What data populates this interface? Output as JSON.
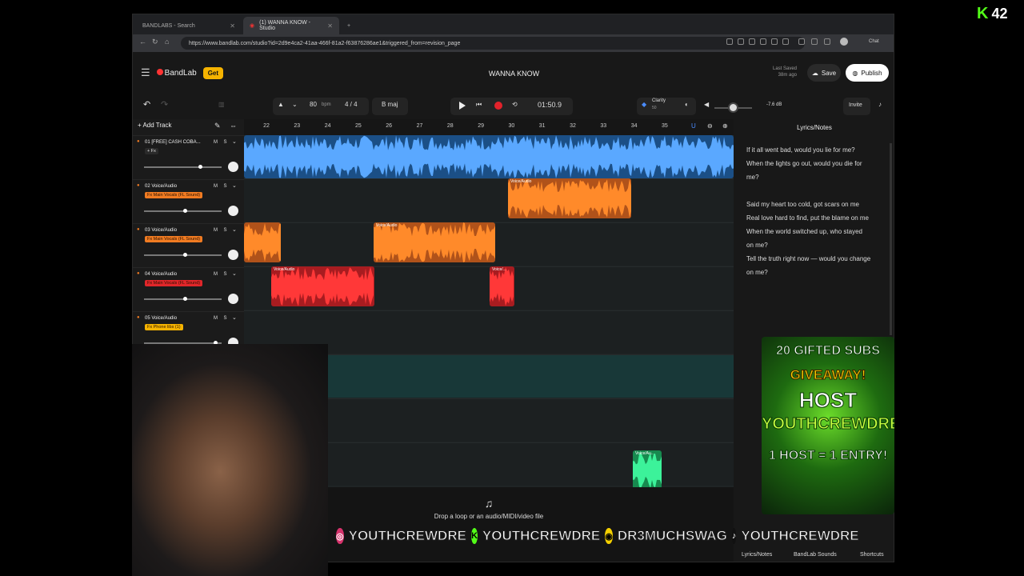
{
  "browser": {
    "tabs": [
      {
        "label": "BANDLABS - Search"
      },
      {
        "label": "(1) WANNA KNOW - Studio"
      }
    ],
    "url": "https://www.bandlab.com/studio?id=2d9e4ca2-41aa-466f-81a2-f63876286ae1&triggered_from=revision_page",
    "chat_label": "Chat"
  },
  "header": {
    "brand": "BandLab",
    "get_label": "Get",
    "title": "WANNA KNOW",
    "last_saved_1": "Last Saved",
    "last_saved_2": "38m ago",
    "save_label": "Save",
    "publish_label": "Publish"
  },
  "toolbar": {
    "bpm": "80",
    "bpm_unit": "bpm",
    "time_sig": "4 / 4",
    "key": "B maj",
    "time": "01:50.9",
    "clarity": "Clarity",
    "clarity_val": "50",
    "db": "-7.6 dB",
    "invite": "Invite"
  },
  "tracks": {
    "add_track": "Add Track",
    "items": [
      {
        "name": "01  [FREE] CASH COBA...",
        "fx": "+ Fx",
        "fx_color": "#2a2a2a",
        "vol": 0.72
      },
      {
        "name": "02  Voice/Audio",
        "fx": "Fx  Main Vocals (FL Sound)",
        "fx_color": "#f07b22",
        "vol": 0.53
      },
      {
        "name": "03  Voice/Audio",
        "fx": "Fx  Main Vocals (FL Sound)",
        "fx_color": "#f07b22",
        "vol": 0.53
      },
      {
        "name": "04  Voice/Audio",
        "fx": "Fx  Main Vocals (FL Sound)",
        "fx_color": "#e0262a",
        "vol": 0.53
      },
      {
        "name": "05  Voice/Audio",
        "fx": "Fx  Phone libs (1)",
        "fx_color": "#f5b300",
        "vol": 0.92
      }
    ]
  },
  "ruler": [
    "22",
    "23",
    "24",
    "25",
    "26",
    "27",
    "28",
    "29",
    "30",
    "31",
    "32",
    "33",
    "34",
    "35"
  ],
  "clips": {
    "label": "Voice/Audio",
    "label_short": "Voice/...",
    "label_green": "Voice/Au..."
  },
  "drop_text": "Drop a loop or an audio/MIDI/video file",
  "lyrics": {
    "title": "Lyrics/Notes",
    "lines": [
      "If it all went bad, would you lie for me?",
      "When the lights go out, would you die for",
      "me?",
      "",
      "Said my heart too cold, got scars on me",
      "Real love hard to find, put the blame on me",
      "When the world switched up, who stayed",
      "on me?",
      "Tell the truth right now — would you change",
      "on me?"
    ],
    "tab_lyrics": "Lyrics/Notes",
    "tab_sounds": "BandLab Sounds",
    "tab_shortcuts": "Shortcuts"
  },
  "overlay": {
    "kick_count": "42",
    "promo_1": "20 GIFTED SUBS",
    "promo_2": "GIVEAWAY!",
    "promo_3": "HOST",
    "promo_4": "YOUTHCREWDRE",
    "promo_5": "1 HOST = 1 ENTRY!",
    "social_1": "YOUTHCREWDRE",
    "social_2": "YOUTHCREWDRE",
    "social_3": "DR3MUCHSWAG",
    "social_4": "YOUTHCREWDRE"
  },
  "colors": {
    "blue_clip": "#2d83d6",
    "orange_clip": "#f07b22",
    "red_clip": "#d9262a",
    "green_clip": "#2bd07a",
    "kick_green": "#53fc18"
  }
}
